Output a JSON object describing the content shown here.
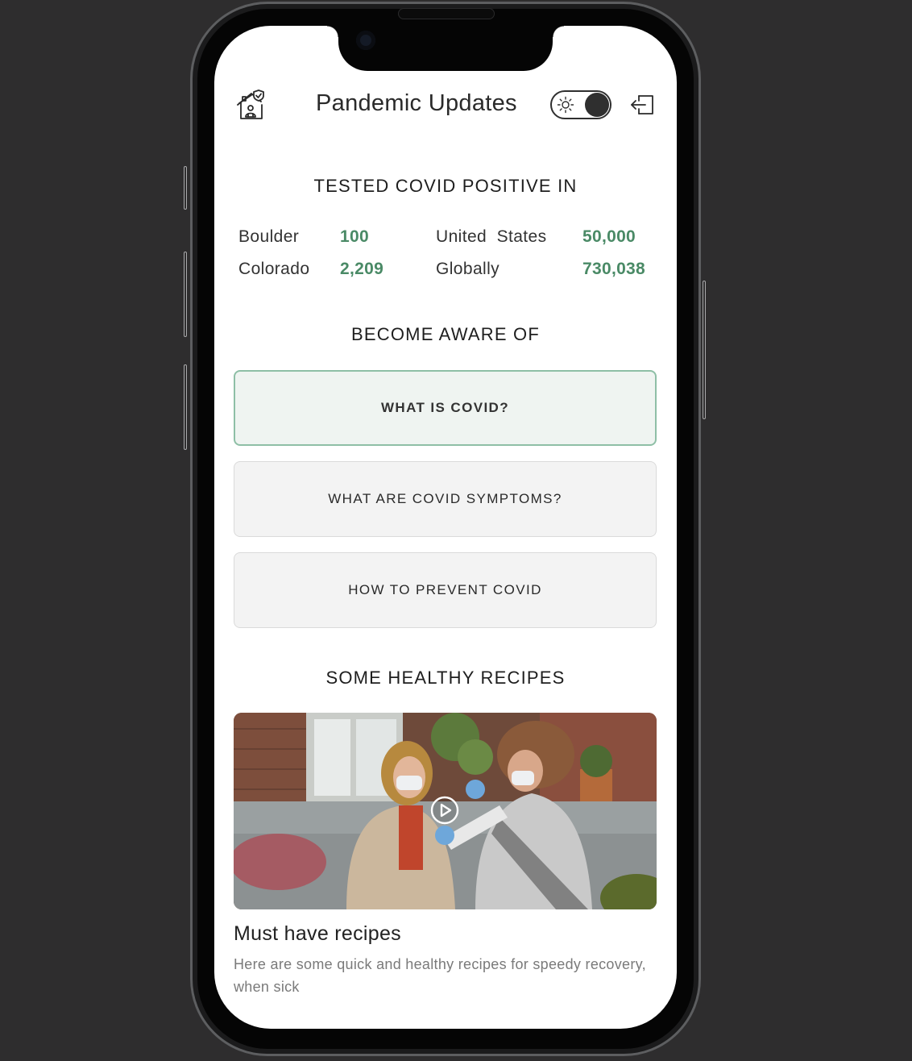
{
  "header": {
    "title": "Pandemic Updates",
    "home_icon": "home-shield-icon",
    "theme_toggle": {
      "icons": [
        "sun-icon"
      ],
      "state": "dark"
    },
    "logout_icon": "logout-icon"
  },
  "stats": {
    "heading": "TESTED COVID POSITIVE IN",
    "rows": [
      {
        "label": "Boulder",
        "value": "100"
      },
      {
        "label": "Colorado",
        "value": "2,209"
      },
      {
        "label": "United  States",
        "value": "50,000"
      },
      {
        "label": "Globally",
        "value": "730,038"
      }
    ],
    "value_color": "#4a8a66"
  },
  "awareness": {
    "heading": "BECOME AWARE OF",
    "buttons": [
      {
        "label": "WHAT IS COVID?",
        "active": true
      },
      {
        "label": "WHAT ARE COVID SYMPTOMS?",
        "active": false
      },
      {
        "label": "HOW TO PREVENT COVID",
        "active": false
      }
    ],
    "accent_color": "#8ebfa6"
  },
  "recipes": {
    "heading": "SOME HEALTHY RECIPES",
    "card": {
      "image_icon": "play-icon",
      "title": "Must have recipes",
      "description": "Here are some quick and healthy recipes for speedy recovery, when sick"
    }
  }
}
